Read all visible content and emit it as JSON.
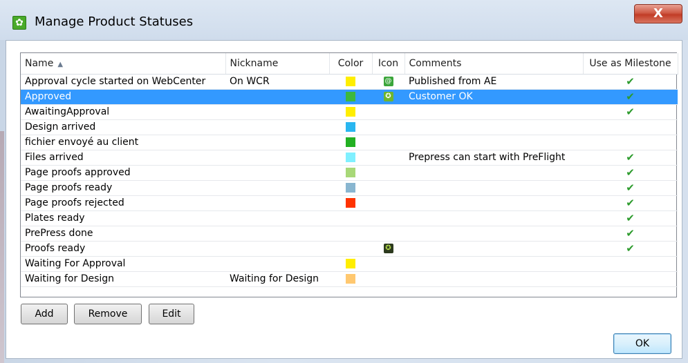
{
  "window": {
    "title": "Manage Product Statuses",
    "close_label": "X"
  },
  "table": {
    "columns": [
      "Name",
      "Nickname",
      "Color",
      "Icon",
      "Comments",
      "Use as Milestone"
    ],
    "sort_indicator": "^",
    "rows": [
      {
        "name": "Approval cycle started on WebCenter",
        "nickname": "On WCR",
        "color": "#ffee00",
        "icon": "webcenter-icon",
        "icon_glyph": "@",
        "icon_bg": "#3aa53a",
        "comment": "Published from AE",
        "milestone": "✔"
      },
      {
        "name": "Approved",
        "nickname": "",
        "color": "#3db83d",
        "icon": "star-badge-icon",
        "icon_glyph": "✪",
        "icon_bg": "#6fb52e",
        "comment": "Customer OK",
        "milestone": "✔"
      },
      {
        "name": "AwaitingApproval",
        "nickname": "",
        "color": "#ffee00",
        "icon": "",
        "icon_glyph": "",
        "icon_bg": "",
        "comment": "",
        "milestone": "✔"
      },
      {
        "name": "Design arrived",
        "nickname": "",
        "color": "#29b6f0",
        "icon": "",
        "icon_glyph": "",
        "icon_bg": "",
        "comment": "",
        "milestone": ""
      },
      {
        "name": "fichier envoyé au client",
        "nickname": "",
        "color": "#22b022",
        "icon": "",
        "icon_glyph": "",
        "icon_bg": "",
        "comment": "",
        "milestone": ""
      },
      {
        "name": "Files arrived",
        "nickname": "",
        "color": "#80f0ff",
        "icon": "",
        "icon_glyph": "",
        "icon_bg": "",
        "comment": "Prepress can start with PreFlight",
        "milestone": "✔"
      },
      {
        "name": "Page proofs approved",
        "nickname": "",
        "color": "#a8d878",
        "icon": "",
        "icon_glyph": "",
        "icon_bg": "",
        "comment": "",
        "milestone": "✔"
      },
      {
        "name": "Page proofs ready",
        "nickname": "",
        "color": "#89b6d0",
        "icon": "",
        "icon_glyph": "",
        "icon_bg": "",
        "comment": "",
        "milestone": "✔"
      },
      {
        "name": "Page proofs rejected",
        "nickname": "",
        "color": "#ff3300",
        "icon": "",
        "icon_glyph": "",
        "icon_bg": "",
        "comment": "",
        "milestone": "✔"
      },
      {
        "name": "Plates ready",
        "nickname": "",
        "color": "",
        "icon": "",
        "icon_glyph": "",
        "icon_bg": "",
        "comment": "",
        "milestone": "✔"
      },
      {
        "name": "PrePress done",
        "nickname": "",
        "color": "",
        "icon": "",
        "icon_glyph": "",
        "icon_bg": "",
        "comment": "",
        "milestone": "✔"
      },
      {
        "name": "Proofs ready",
        "nickname": "",
        "color": "",
        "icon": "proof-star-icon",
        "icon_glyph": "✪",
        "icon_bg": "#2c3a1e",
        "comment": "",
        "milestone": "✔"
      },
      {
        "name": "Waiting For Approval",
        "nickname": "",
        "color": "#ffee00",
        "icon": "",
        "icon_glyph": "",
        "icon_bg": "",
        "comment": "",
        "milestone": ""
      },
      {
        "name": "Waiting for Design",
        "nickname": "Waiting for Design",
        "color": "#ffc870",
        "icon": "",
        "icon_glyph": "",
        "icon_bg": "",
        "comment": "",
        "milestone": ""
      }
    ],
    "selected_row": 1
  },
  "buttons": {
    "add": "Add",
    "remove": "Remove",
    "edit": "Edit",
    "ok": "OK"
  }
}
